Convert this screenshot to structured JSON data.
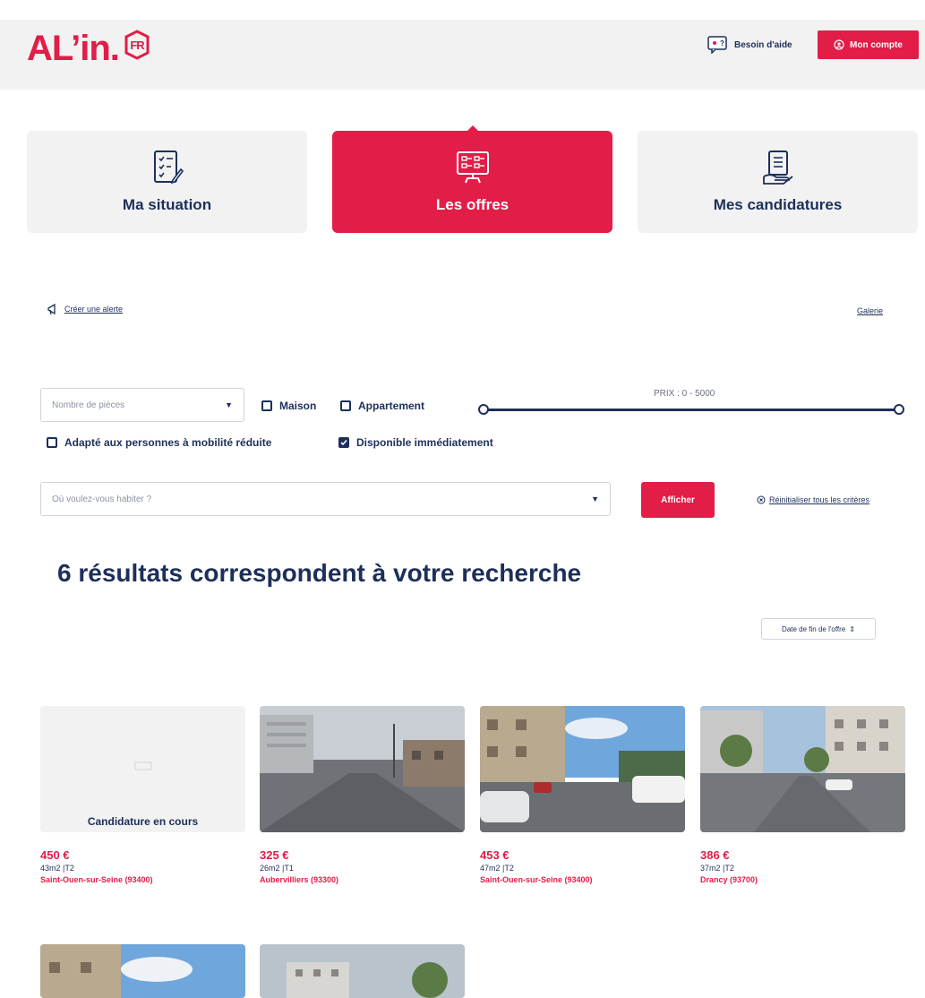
{
  "header": {
    "logo_text": "AL’in.",
    "logo_badge": "FR",
    "help_label": "Besoin d'aide",
    "account_label": "Mon compte"
  },
  "tabs": [
    {
      "label": "Ma situation",
      "icon": "checklist-pen-icon",
      "active": false
    },
    {
      "label": "Les offres",
      "icon": "listing-board-icon",
      "active": true
    },
    {
      "label": "Mes candidatures",
      "icon": "document-hand-icon",
      "active": false
    }
  ],
  "links": {
    "create_alert": "Créer une alerte",
    "gallery": "Galerie",
    "reset": "Réinitialiser tous les critères"
  },
  "filters": {
    "rooms_placeholder": "Nombre de pièces",
    "house_label": "Maison",
    "apartment_label": "Appartement",
    "reduced_mobility_label": "Adapté aux personnes à mobilité réduite",
    "available_now_label": "Disponible immédiatement",
    "house_checked": false,
    "apartment_checked": false,
    "reduced_mobility_checked": false,
    "available_now_checked": true,
    "price_label": "PRIX : 0 - 5000",
    "price_min": 0,
    "price_max": 5000,
    "place_placeholder": "Où voulez-vous habiter ?",
    "show_button": "Afficher"
  },
  "results": {
    "title": "6 résultats correspondent à votre recherche",
    "sort_label": "Date de fin de l'offre"
  },
  "listings": [
    {
      "price": "450 €",
      "meta": "43m2 |T2",
      "city": "Saint-Ouen-sur-Seine (93400)",
      "status": "Candidature en cours",
      "has_photo": false
    },
    {
      "price": "325 €",
      "meta": "26m2 |T1",
      "city": "Aubervilliers (93300)",
      "status": "",
      "has_photo": true
    },
    {
      "price": "453 €",
      "meta": "47m2 |T2",
      "city": "Saint-Ouen-sur-Seine (93400)",
      "status": "",
      "has_photo": true
    },
    {
      "price": "386 €",
      "meta": "37m2 |T2",
      "city": "Drancy (93700)",
      "status": "",
      "has_photo": true
    }
  ],
  "colors": {
    "brand_red": "#e11d48",
    "navy": "#1d2f5a",
    "panel_gray": "#f2f2f2"
  }
}
